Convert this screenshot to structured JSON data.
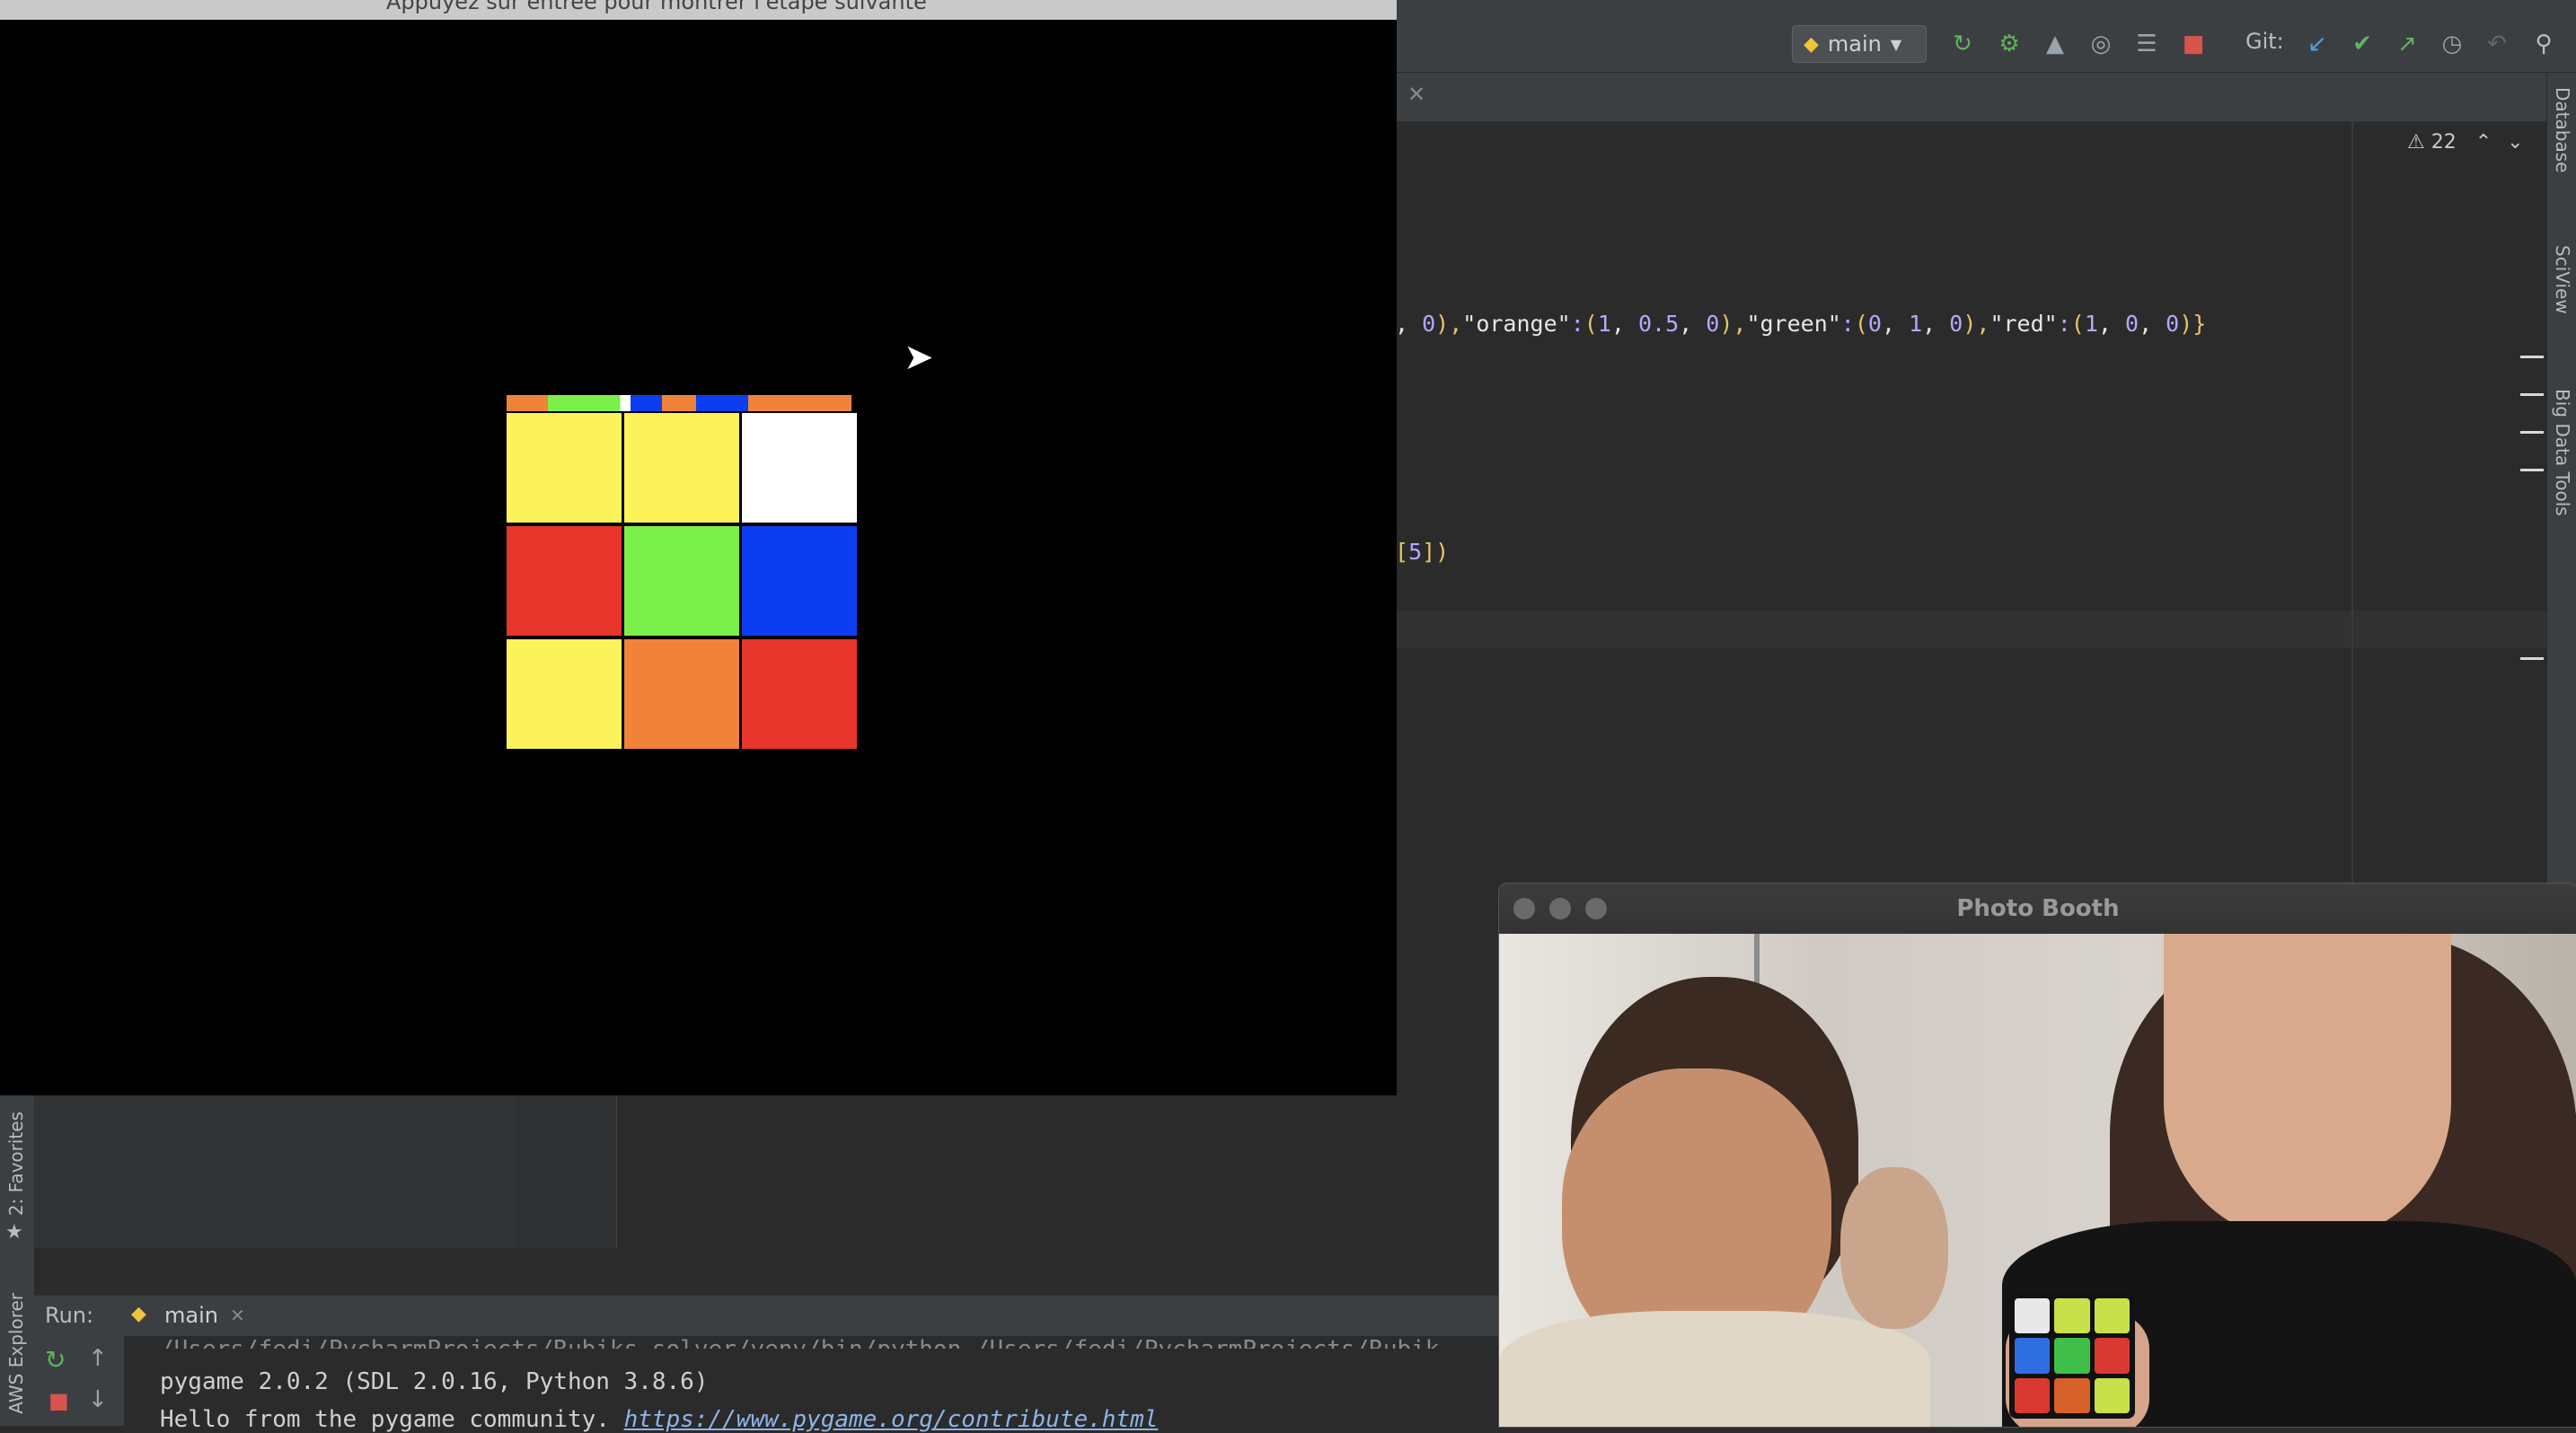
{
  "pygame_window": {
    "title_partial": "Appuyez sur entrée pour montrer l'étape suivante",
    "cube_front_face": [
      [
        "#fcf25a",
        "#fcf25a",
        "#ffffff"
      ],
      [
        "#e8352b",
        "#7cf04a",
        "#0a3ef0"
      ],
      [
        "#fcf25a",
        "#f0823a",
        "#e8352b"
      ]
    ]
  },
  "ide": {
    "run_config": "main",
    "git_label": "Git:",
    "warnings_count": "22",
    "code_line_1": [
      {
        "t": ", ",
        "c": "str"
      },
      {
        "t": "0",
        "c": "num"
      },
      {
        "t": "),",
        "c": "p"
      },
      {
        "t": "\"orange\"",
        "c": "str"
      },
      {
        "t": ":",
        "c": "num"
      },
      {
        "t": "(",
        "c": "p"
      },
      {
        "t": "1",
        "c": "num"
      },
      {
        "t": ", ",
        "c": "str"
      },
      {
        "t": "0.5",
        "c": "num"
      },
      {
        "t": ", ",
        "c": "str"
      },
      {
        "t": "0",
        "c": "num"
      },
      {
        "t": "),",
        "c": "p"
      },
      {
        "t": "\"green\"",
        "c": "str"
      },
      {
        "t": ":",
        "c": "num"
      },
      {
        "t": "(",
        "c": "p"
      },
      {
        "t": "0",
        "c": "num"
      },
      {
        "t": ", ",
        "c": "str"
      },
      {
        "t": "1",
        "c": "num"
      },
      {
        "t": ", ",
        "c": "str"
      },
      {
        "t": "0",
        "c": "num"
      },
      {
        "t": "),",
        "c": "p"
      },
      {
        "t": "\"red\"",
        "c": "str"
      },
      {
        "t": ":",
        "c": "num"
      },
      {
        "t": "(",
        "c": "p"
      },
      {
        "t": "1",
        "c": "num"
      },
      {
        "t": ", ",
        "c": "str"
      },
      {
        "t": "0",
        "c": "num"
      },
      {
        "t": ", ",
        "c": "str"
      },
      {
        "t": "0",
        "c": "num"
      },
      {
        "t": ")}",
        "c": "p"
      }
    ],
    "code_line_2_num": "5",
    "code_line_2_close": "])",
    "right_tabs": [
      "Database",
      "SciView",
      "Big Data Tools"
    ],
    "left_tabs": [
      "2: Favorites",
      "AWS Explorer"
    ],
    "run": {
      "label": "Run:",
      "tab": "main",
      "console_line_1": "pygame 2.0.2 (SDL 2.0.16, Python 3.8.6)",
      "console_line_2": "Hello from the pygame community. ",
      "console_link": "https://www.pygame.org/contribute.html"
    }
  },
  "photo_booth": {
    "title": "Photo Booth"
  },
  "colors": {
    "editor_bg": "#2b2b2b",
    "panel_bg": "#3c3f41"
  }
}
